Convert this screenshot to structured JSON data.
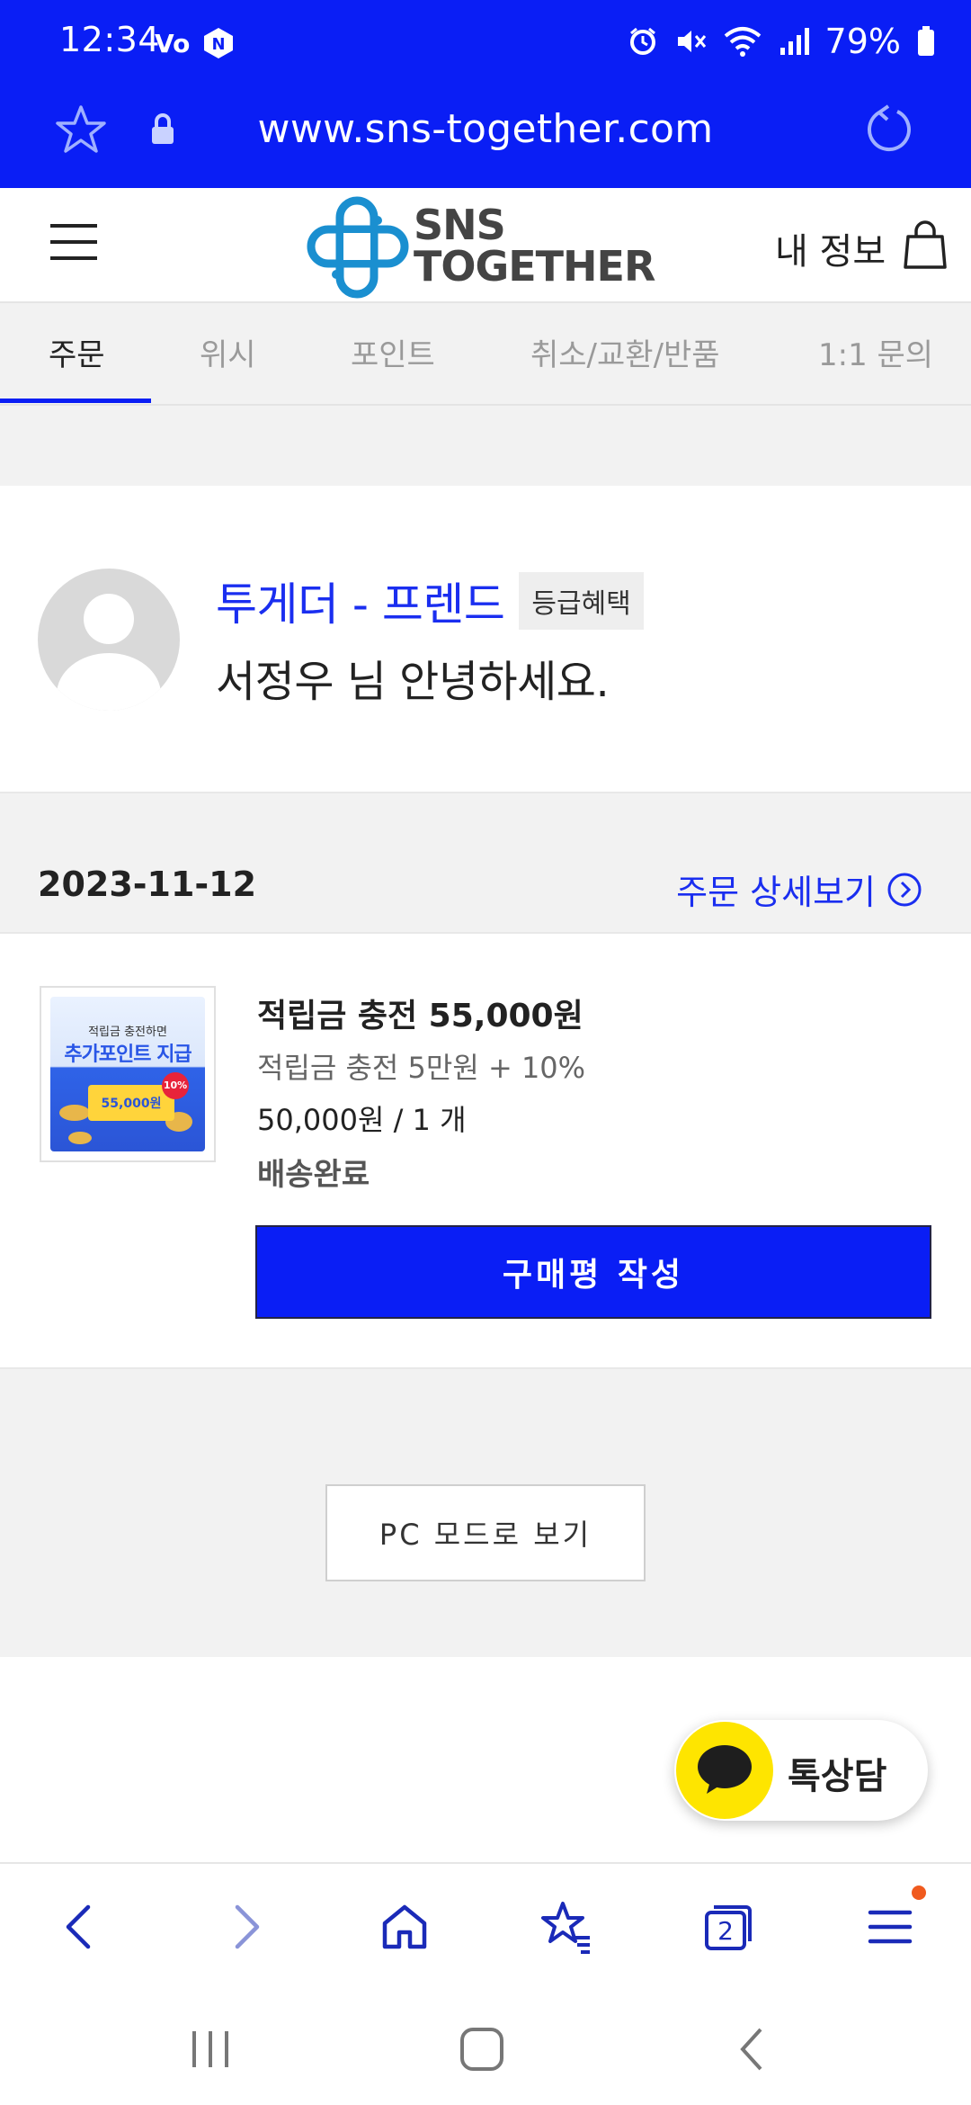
{
  "status_bar": {
    "time": "12:34",
    "battery": "79%",
    "icons_left": [
      "volte-icon",
      "n-app-icon"
    ],
    "icons_right": [
      "alarm-icon",
      "mute-icon",
      "wifi-icon",
      "signal-icon",
      "battery-icon"
    ]
  },
  "browser": {
    "url": "www.sns-together.com"
  },
  "header": {
    "logo_line1": "SNS",
    "logo_line2": "TOGETHER",
    "my_info": "내 정보"
  },
  "tabs": [
    {
      "label": "주문",
      "active": true
    },
    {
      "label": "위시",
      "active": false
    },
    {
      "label": "포인트",
      "active": false
    },
    {
      "label": "취소/교환/반품",
      "active": false
    },
    {
      "label": "1:1 문의",
      "active": false
    }
  ],
  "profile": {
    "grade": "투게더 - 프렌드",
    "grade_benefit": "등급혜택",
    "greeting": "서정우 님 안녕하세요."
  },
  "order": {
    "date": "2023-11-12",
    "detail_link": "주문 상세보기",
    "thumbnail": {
      "line1": "적립금 충전하면",
      "line2": "추가포인트 지급",
      "ticket": "55,000원",
      "badge": "10%"
    },
    "product_name": "적립금 충전 55,000원",
    "option": "적립금 충전 5만원 + 10%",
    "price_qty": "50,000원 / 1 개",
    "status": "배송완료",
    "review_button": "구매평 작성"
  },
  "pc_mode": "PC 모드로 보기",
  "kakao": {
    "label": "톡상담"
  },
  "bottom_bar": {
    "tab_count": "2",
    "buttons": [
      "back-icon",
      "forward-icon",
      "home-icon",
      "bookmarks-icon",
      "tabs-icon",
      "menu-icon"
    ]
  },
  "colors": {
    "primary": "#0a1ef5",
    "link": "#1a2ef0",
    "kakao_yellow": "#fee500",
    "notification_dot": "#f05a1e"
  }
}
